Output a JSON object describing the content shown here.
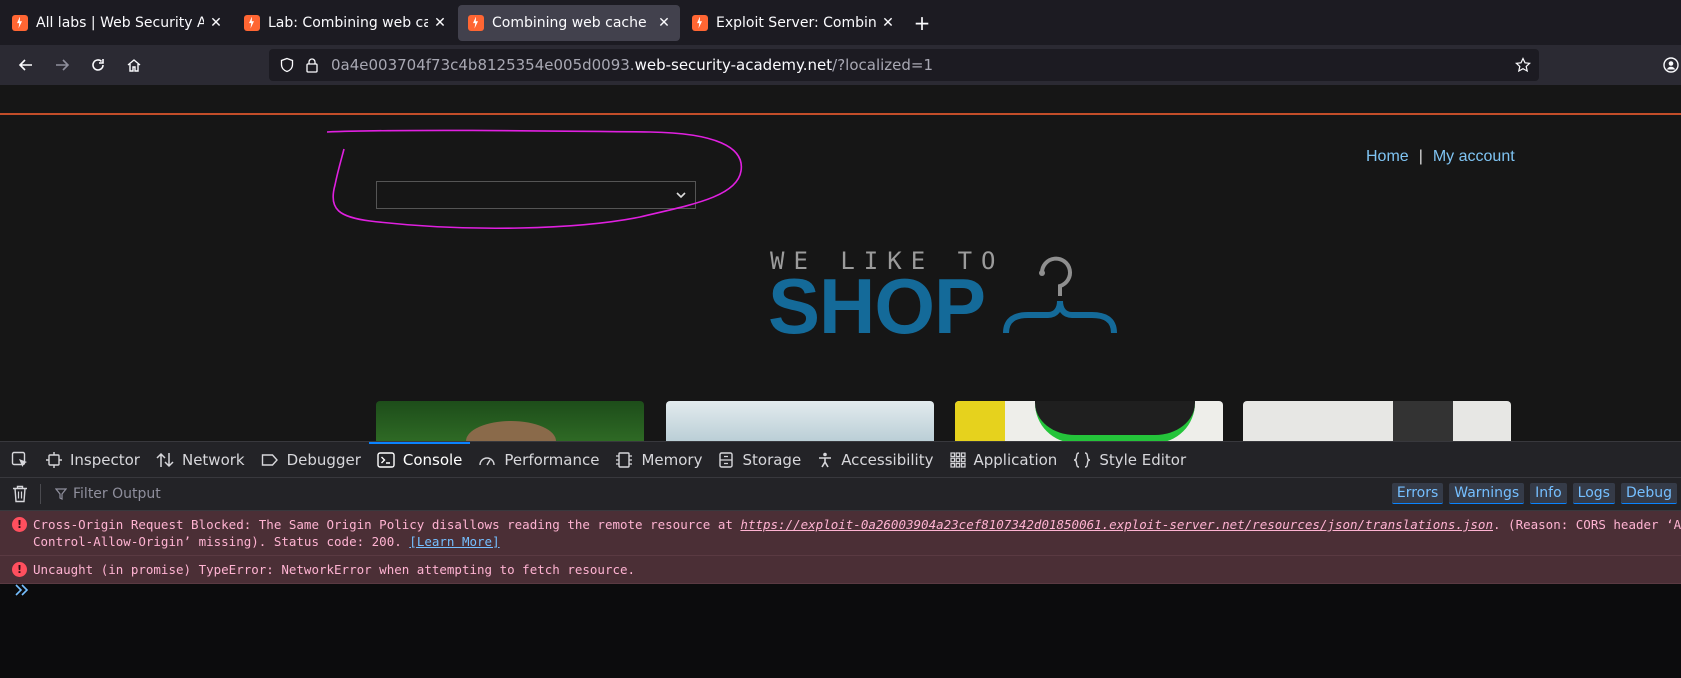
{
  "browser": {
    "tabs": [
      {
        "title": "All labs | Web Security Academy",
        "active": false
      },
      {
        "title": "Lab: Combining web cache poisoning",
        "active": false
      },
      {
        "title": "Combining web cache poisoning",
        "active": true
      },
      {
        "title": "Exploit Server: Combining web cache",
        "active": false
      }
    ],
    "new_tab_label": "+",
    "close_label": "✕",
    "url": {
      "prefix": "0a4e003704f73c4b8125354e005d0093.",
      "host": "web-security-academy.net",
      "path": "/?localized=1"
    }
  },
  "page": {
    "nav": {
      "home": "Home",
      "separator": "|",
      "account": "My account"
    },
    "logo": {
      "tagline": "WE LIKE TO",
      "word": "SHOP"
    },
    "language_select": {
      "value": ""
    },
    "annotation_color": "#e020e0",
    "accent_color": "#c24d29"
  },
  "devtools": {
    "tabs": [
      {
        "label": "Inspector",
        "icon": "inspector-icon"
      },
      {
        "label": "Network",
        "icon": "network-icon"
      },
      {
        "label": "Debugger",
        "icon": "debugger-icon"
      },
      {
        "label": "Console",
        "icon": "console-icon",
        "active": true
      },
      {
        "label": "Performance",
        "icon": "performance-icon"
      },
      {
        "label": "Memory",
        "icon": "memory-icon"
      },
      {
        "label": "Storage",
        "icon": "storage-icon"
      },
      {
        "label": "Accessibility",
        "icon": "accessibility-icon"
      },
      {
        "label": "Application",
        "icon": "application-icon"
      },
      {
        "label": "Style Editor",
        "icon": "style-editor-icon"
      }
    ],
    "filter_placeholder": "Filter Output",
    "filters": [
      "Errors",
      "Warnings",
      "Info",
      "Logs",
      "Debug"
    ],
    "messages": [
      {
        "line1_pre": "Cross-Origin Request Blocked: The Same Origin Policy disallows reading the remote resource at ",
        "line1_link": "https://exploit-0a26003904a23cef8107342d01850061.exploit-server.net/resources/json/translations.json",
        "line1_post": ". (Reason: CORS header ‘Access-",
        "line2": "Control-Allow-Origin’ missing). Status code: 200. ",
        "learn_more": "[Learn More]"
      },
      {
        "text": "Uncaught (in promise) TypeError: NetworkError when attempting to fetch resource."
      }
    ],
    "prompt": "»"
  }
}
